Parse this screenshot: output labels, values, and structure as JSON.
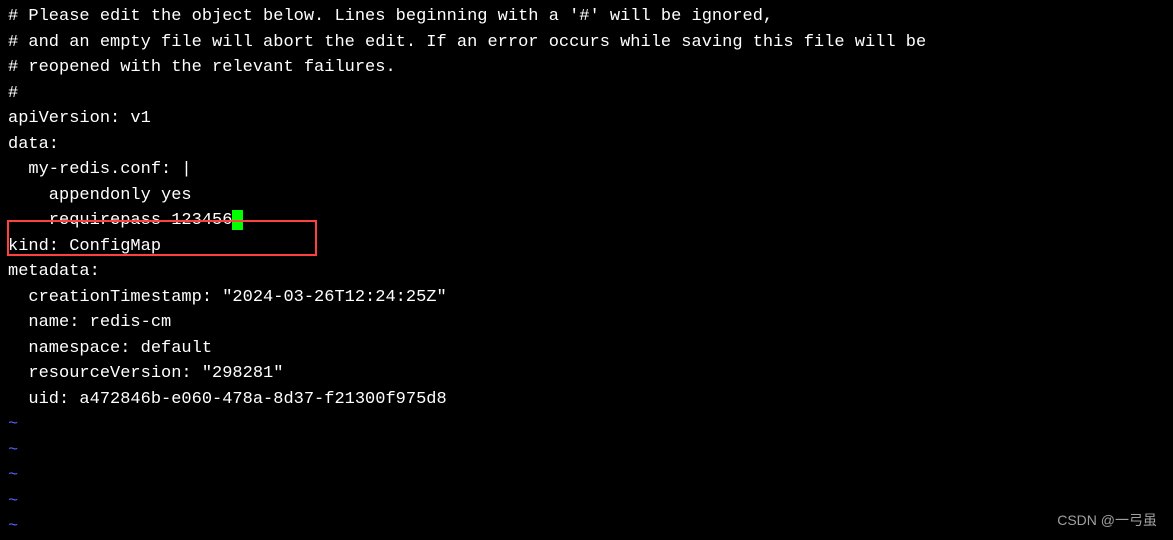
{
  "editor": {
    "comment1": "# Please edit the object below. Lines beginning with a '#' will be ignored,",
    "comment2": "# and an empty file will abort the edit. If an error occurs while saving this file will be",
    "comment3": "# reopened with the relevant failures.",
    "comment4": "#",
    "yaml": {
      "apiVersion_line": "apiVersion: v1",
      "data_line": "data:",
      "confkey_line": "  my-redis.conf: |",
      "appendonly_line": "    appendonly yes",
      "requirepass_line": "    requirepass 123456",
      "kind_line": "kind: ConfigMap",
      "metadata_line": "metadata:",
      "creationTimestamp_line": "  creationTimestamp: \"2024-03-26T12:24:25Z\"",
      "name_line": "  name: redis-cm",
      "namespace_line": "  namespace: default",
      "resourceVersion_line": "  resourceVersion: \"298281\"",
      "uid_line": "  uid: a472846b-e060-478a-8d37-f21300f975d8"
    },
    "tilde": "~"
  },
  "watermark": "CSDN @一弓虽"
}
